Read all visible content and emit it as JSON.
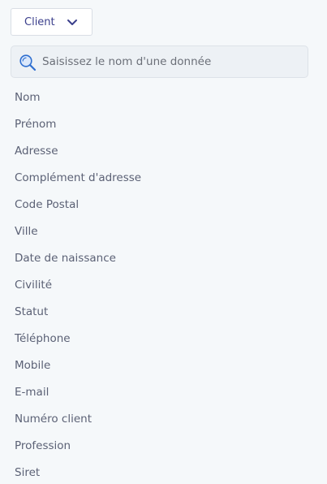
{
  "entity_select": {
    "label": "Client",
    "icon": "chevron-down-icon"
  },
  "search": {
    "placeholder": "Saisissez le nom d'une donnée",
    "value": "",
    "icon": "search-icon"
  },
  "fields": [
    "Nom",
    "Prénom",
    "Adresse",
    "Complément d'adresse",
    "Code Postal",
    "Ville",
    "Date de naissance",
    "Civilité",
    "Statut",
    "Téléphone",
    "Mobile",
    "E-mail",
    "Numéro client",
    "Profession",
    "Siret"
  ],
  "colors": {
    "background": "#f5f8fa",
    "accent": "#3b3f8c",
    "text": "#5b6175",
    "search_icon": "#2f6fd0"
  }
}
